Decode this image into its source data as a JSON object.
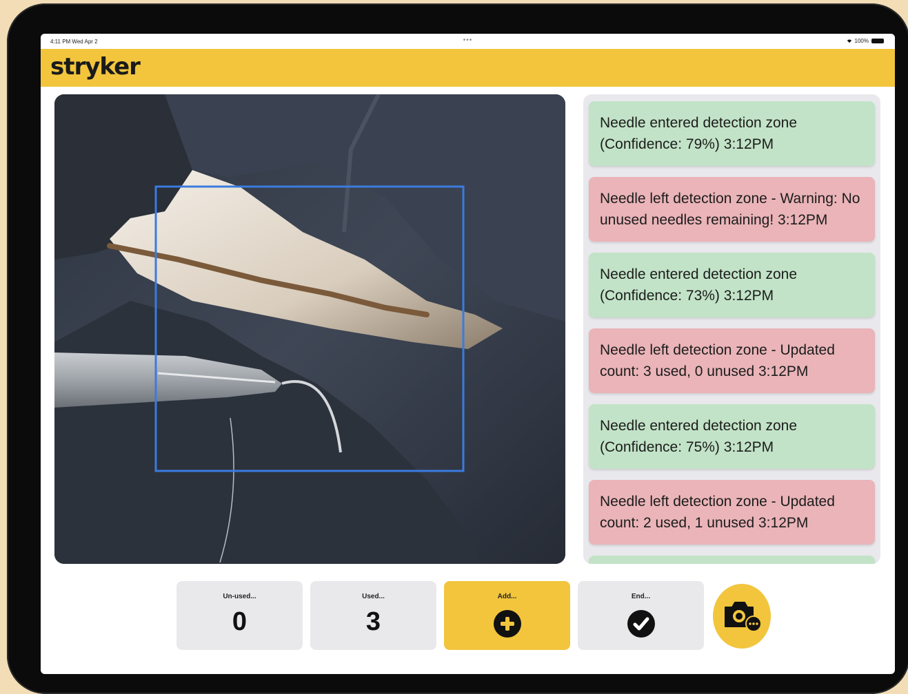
{
  "status_bar": {
    "time_date": "4:11 PM  Wed Apr 2",
    "dots": "•••",
    "battery": "100%"
  },
  "header": {
    "logo_text": "stryker",
    "brand_color": "#f2c53d"
  },
  "camera_view": {
    "detection_box_color": "#3a7be0"
  },
  "log": {
    "entries": [
      {
        "type": "entered",
        "text": "Needle entered detection zone (Confidence: 79%) 3:12PM"
      },
      {
        "type": "left",
        "text": "Needle left detection zone - Warning: No unused needles remaining! 3:12PM"
      },
      {
        "type": "entered",
        "text": "Needle entered detection zone (Confidence: 73%) 3:12PM"
      },
      {
        "type": "left",
        "text": "Needle left detection zone - Updated count: 3 used, 0 unused 3:12PM"
      },
      {
        "type": "entered",
        "text": "Needle entered detection zone (Confidence: 75%) 3:12PM"
      },
      {
        "type": "left",
        "text": "Needle left detection zone - Updated count: 2 used, 1 unused 3:12PM"
      }
    ],
    "entered_color": "#c2e3c7",
    "left_color": "#eab4b8"
  },
  "controls": {
    "unused": {
      "label": "Un-used...",
      "value": "0"
    },
    "used": {
      "label": "Used...",
      "value": "3"
    },
    "add": {
      "label": "Add...",
      "icon": "plus-circle-icon"
    },
    "end": {
      "label": "End...",
      "icon": "checkmark-circle-icon"
    },
    "camera": {
      "icon": "camera-more-icon"
    }
  }
}
